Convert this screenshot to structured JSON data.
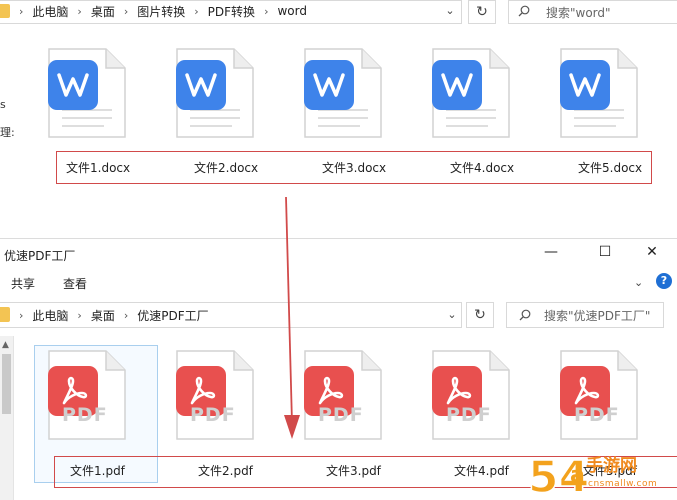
{
  "top_window": {
    "breadcrumbs": [
      "此电脑",
      "桌面",
      "图片转换",
      "PDF转换",
      "word"
    ],
    "search_placeholder": "搜索\"word\"",
    "side_labels": [
      "s",
      "理:"
    ],
    "files": [
      "文件1.docx",
      "文件2.docx",
      "文件3.docx",
      "文件4.docx",
      "文件5.docx"
    ]
  },
  "bottom_window": {
    "title": "优速PDF工厂",
    "ribbon_tabs": [
      "共享",
      "查看"
    ],
    "help_label": "?",
    "breadcrumbs": [
      "此电脑",
      "桌面",
      "优速PDF工厂"
    ],
    "search_placeholder": "搜索\"优速PDF工厂\"",
    "files": [
      "文件1.pdf",
      "文件2.pdf",
      "文件3.pdf",
      "文件4.pdf",
      "文件5.pdf"
    ],
    "pdf_label": "PDF"
  },
  "watermark": {
    "text": "手游网",
    "digits": "54a",
    "sub": "cnsmallw.com"
  },
  "colors": {
    "word_blue": "#3e83ea",
    "pdf_red": "#e8504f",
    "highlight_red": "#d14a4a",
    "folder_yellow": "#f3c453"
  },
  "icons": {
    "word_file": "word-file-icon",
    "pdf_file": "pdf-file-icon",
    "refresh": "refresh-icon",
    "search": "search-icon",
    "folder": "folder-icon",
    "minimize": "minimize-icon",
    "maximize": "maximize-icon",
    "close": "close-icon"
  }
}
